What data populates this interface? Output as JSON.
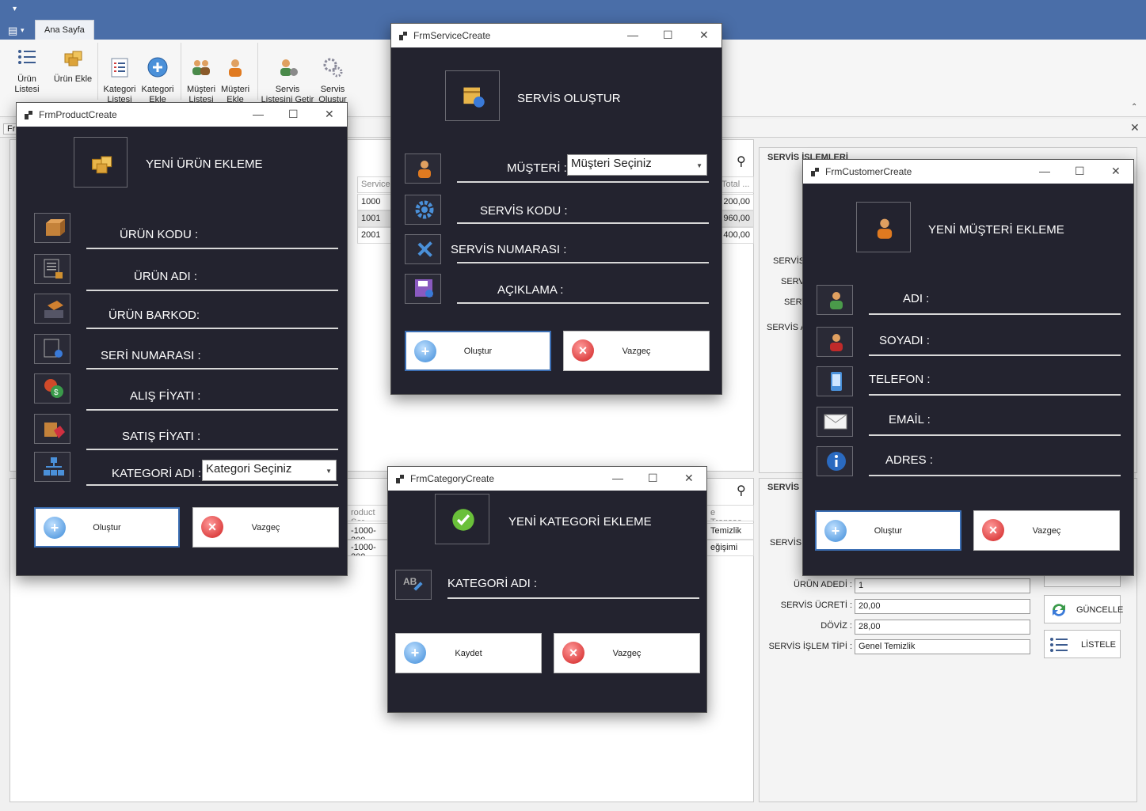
{
  "app": {
    "ribbon_tab": "Ana Sayfa",
    "ribbon_buttons": [
      {
        "label": "Ürün Listesi",
        "icon": "list-icon"
      },
      {
        "label": "Ürün Ekle",
        "icon": "boxes-icon"
      },
      {
        "label": "Kategori\nListesi",
        "icon": "category-list-icon"
      },
      {
        "label": "Kategori\nEkle",
        "icon": "add-circle-icon"
      },
      {
        "label": "Müşteri\nListesi",
        "icon": "users-icon"
      },
      {
        "label": "Müşteri\nEkle",
        "icon": "customer-icon"
      },
      {
        "label": "Servis\nListesini Getir",
        "icon": "service-list-icon"
      },
      {
        "label": "Servis\nOluştur",
        "icon": "gears-icon"
      }
    ]
  },
  "background": {
    "tab_label": "Fr",
    "grid_header": [
      "Service",
      "Total ..."
    ],
    "grid_rows": [
      {
        "code": "1000",
        "total": "200,00"
      },
      {
        "code": "1001",
        "total": "960,00"
      },
      {
        "code": "2001",
        "total": "400,00"
      }
    ],
    "lower_grid_header": [
      "roduct Ser",
      "e Transac..."
    ],
    "lower_grid_rows": [
      {
        "a": "-1000-200",
        "b": "Temizlik"
      },
      {
        "a": "-1000-200",
        "b": "eğişimi"
      }
    ],
    "servis_islemleri_title": "SERVİS İŞLEMLERİ",
    "servis_panel2_title": "SERVİS",
    "side_labels": [
      "SERVİS",
      "SERV",
      "SERV",
      "SERVİS A",
      "SERVİS"
    ],
    "fields": [
      {
        "label": "ÜRÜN ADEDİ :",
        "value": "1"
      },
      {
        "label": "SERVİS ÜCRETİ :",
        "value": "20,00"
      },
      {
        "label": "DÖVİZ :",
        "value": "28,00"
      },
      {
        "label": "SERVİS İŞLEM TİPİ :",
        "value": "Genel Temizlik"
      }
    ],
    "guncelle_label": "GÜNCELLE",
    "listele_label": "LİSTELE"
  },
  "product_window": {
    "title": "FrmProductCreate",
    "header": "YENİ ÜRÜN EKLEME",
    "labels": [
      "ÜRÜN KODU :",
      "ÜRÜN ADI :",
      "ÜRÜN BARKOD:",
      "SERİ NUMARASI :",
      "ALIŞ FİYATI :",
      "SATIŞ FİYATI :",
      "KATEGORİ ADI :"
    ],
    "category_combo": "Kategori Seçiniz",
    "create_label": "Oluştur",
    "cancel_label": "Vazgeç"
  },
  "service_window": {
    "title": "FrmServiceCreate",
    "header": "SERVİS OLUŞTUR",
    "labels": [
      "MÜŞTERİ :",
      "SERVİS KODU :",
      "SERVİS NUMARASI :",
      "AÇIKLAMA :"
    ],
    "customer_combo": "Müşteri Seçiniz",
    "create_label": "Oluştur",
    "cancel_label": "Vazgeç"
  },
  "category_window": {
    "title": "FrmCategoryCreate",
    "header": "YENİ KATEGORİ EKLEME",
    "label": "KATEGORİ ADI :",
    "save_label": "Kaydet",
    "cancel_label": "Vazgeç"
  },
  "customer_window": {
    "title": "FrmCustomerCreate",
    "header": "YENİ MÜŞTERİ EKLEME",
    "labels": [
      "ADI :",
      "SOYADI :",
      "TELEFON  :",
      "EMAİL :",
      "ADRES :"
    ],
    "create_label": "Oluştur",
    "cancel_label": "Vazgeç"
  }
}
